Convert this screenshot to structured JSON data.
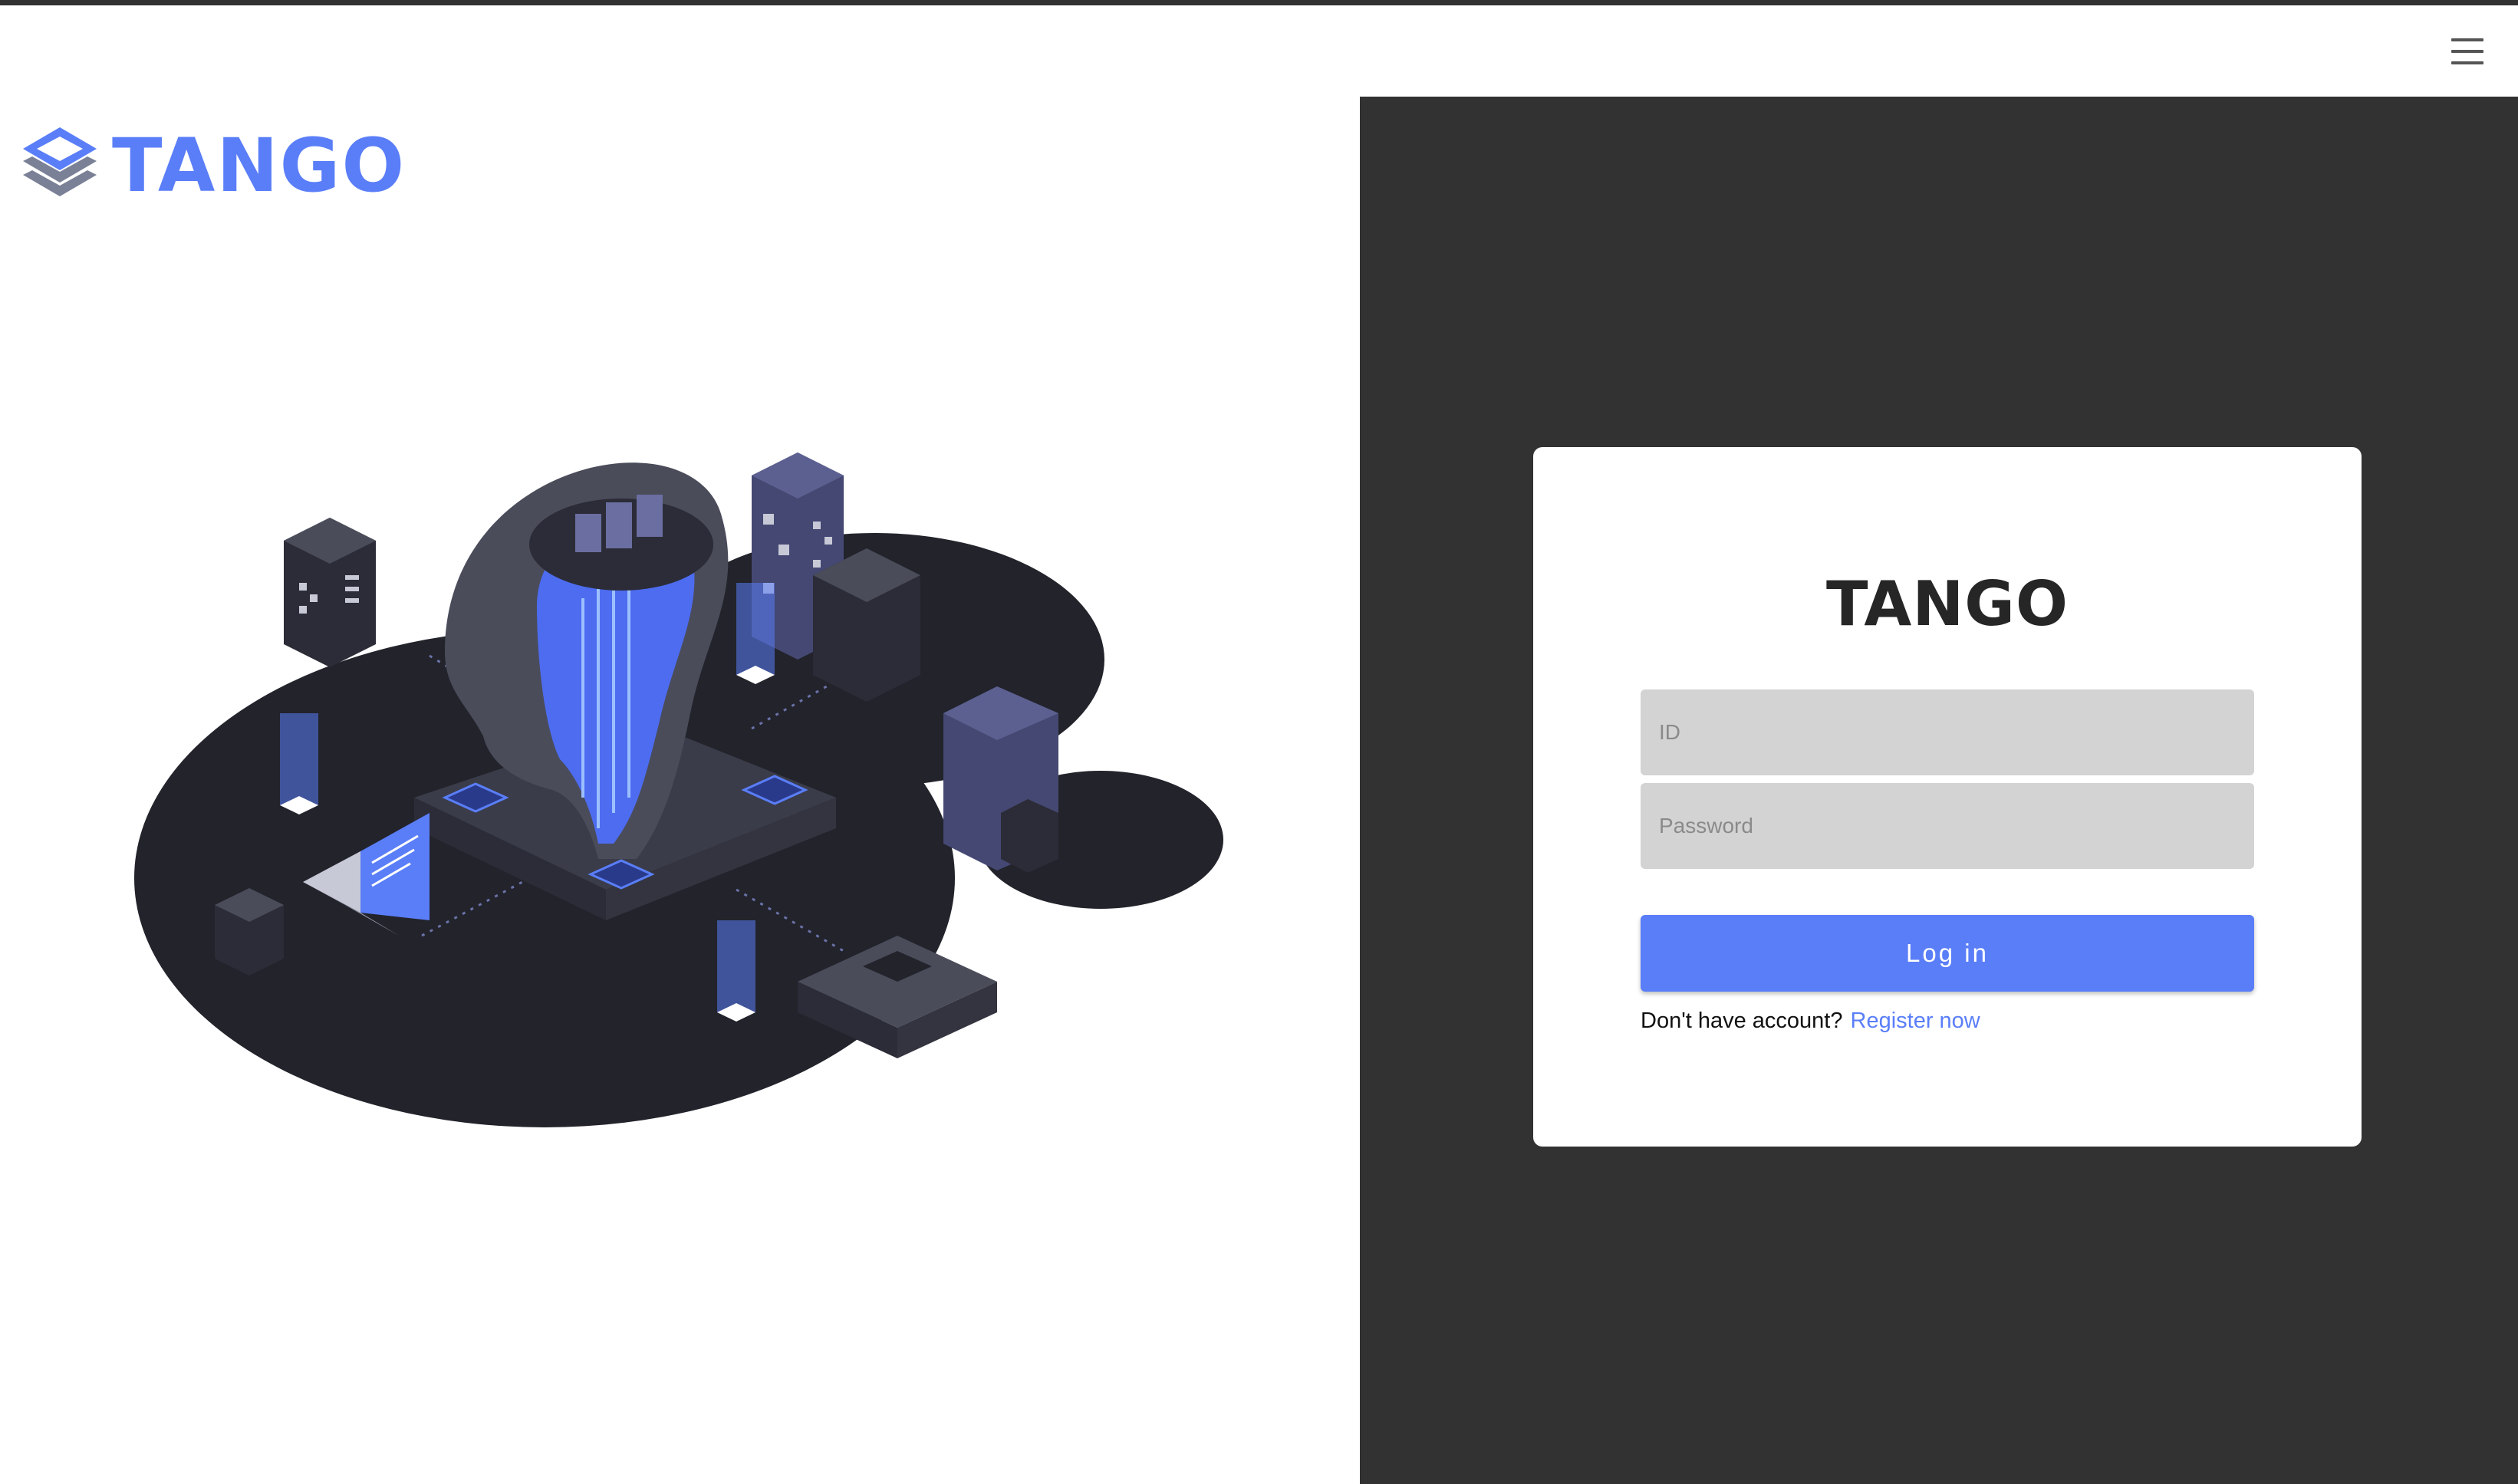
{
  "header": {
    "menu_icon": "hamburger-menu-icon",
    "logo_icon": "stacked-layers-icon",
    "logo_text": "TANGO"
  },
  "illustration": {
    "icon": "isometric-ai-network-illustration"
  },
  "login": {
    "title": "TANGO",
    "id_placeholder": "ID",
    "password_placeholder": "Password",
    "submit_label": "Log in",
    "register_prompt": "Don't have account?",
    "register_link": "Register now"
  },
  "colors": {
    "accent": "#5a7ef8",
    "dark_panel": "#323232",
    "input_bg": "#d3d3d3",
    "card_bg": "#ffffff"
  }
}
